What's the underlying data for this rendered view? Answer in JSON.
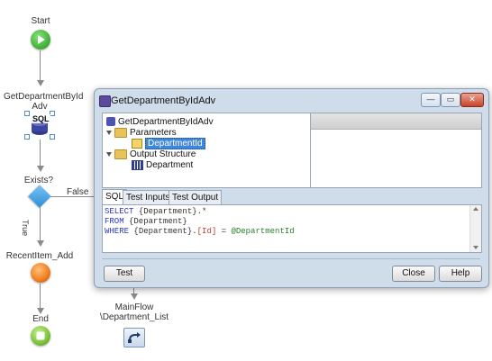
{
  "flow": {
    "start": "Start",
    "node1_line1": "GetDepartmentById",
    "node1_line2": "Adv",
    "sql_badge": "SQL",
    "exists": "Exists?",
    "false_label": "False",
    "true_label": "True",
    "recent": "RecentItem_Add",
    "end": "End",
    "mainflow_line1": "MainFlow",
    "mainflow_line2": "\\Department_List"
  },
  "dialog": {
    "title": "GetDepartmentByIdAdv",
    "min": "—",
    "max": "▭",
    "close": "✕",
    "tree": {
      "root": "GetDepartmentByIdAdv",
      "parameters": "Parameters",
      "param1": "DepartmentId",
      "output": "Output Structure",
      "output1": "Department"
    },
    "tabs": [
      "SQL",
      "Test Inputs",
      "Test Output"
    ],
    "sql": {
      "l1_kw": "SELECT",
      "l1_rest": " {Department}.*",
      "l2_kw": "FROM",
      "l2_rest": " {Department}",
      "l3_kw": "WHERE",
      "l3_a": " {Department}.",
      "l3_attr": "[Id]",
      "l3_eq": " = ",
      "l3_param": "@DepartmentId"
    },
    "buttons": {
      "test": "Test",
      "close": "Close",
      "help": "Help"
    }
  },
  "colors": {
    "start": "#44b63a",
    "exists": "#2a8fd8",
    "recent": "#f07d1e",
    "end": "#7cc23a"
  }
}
